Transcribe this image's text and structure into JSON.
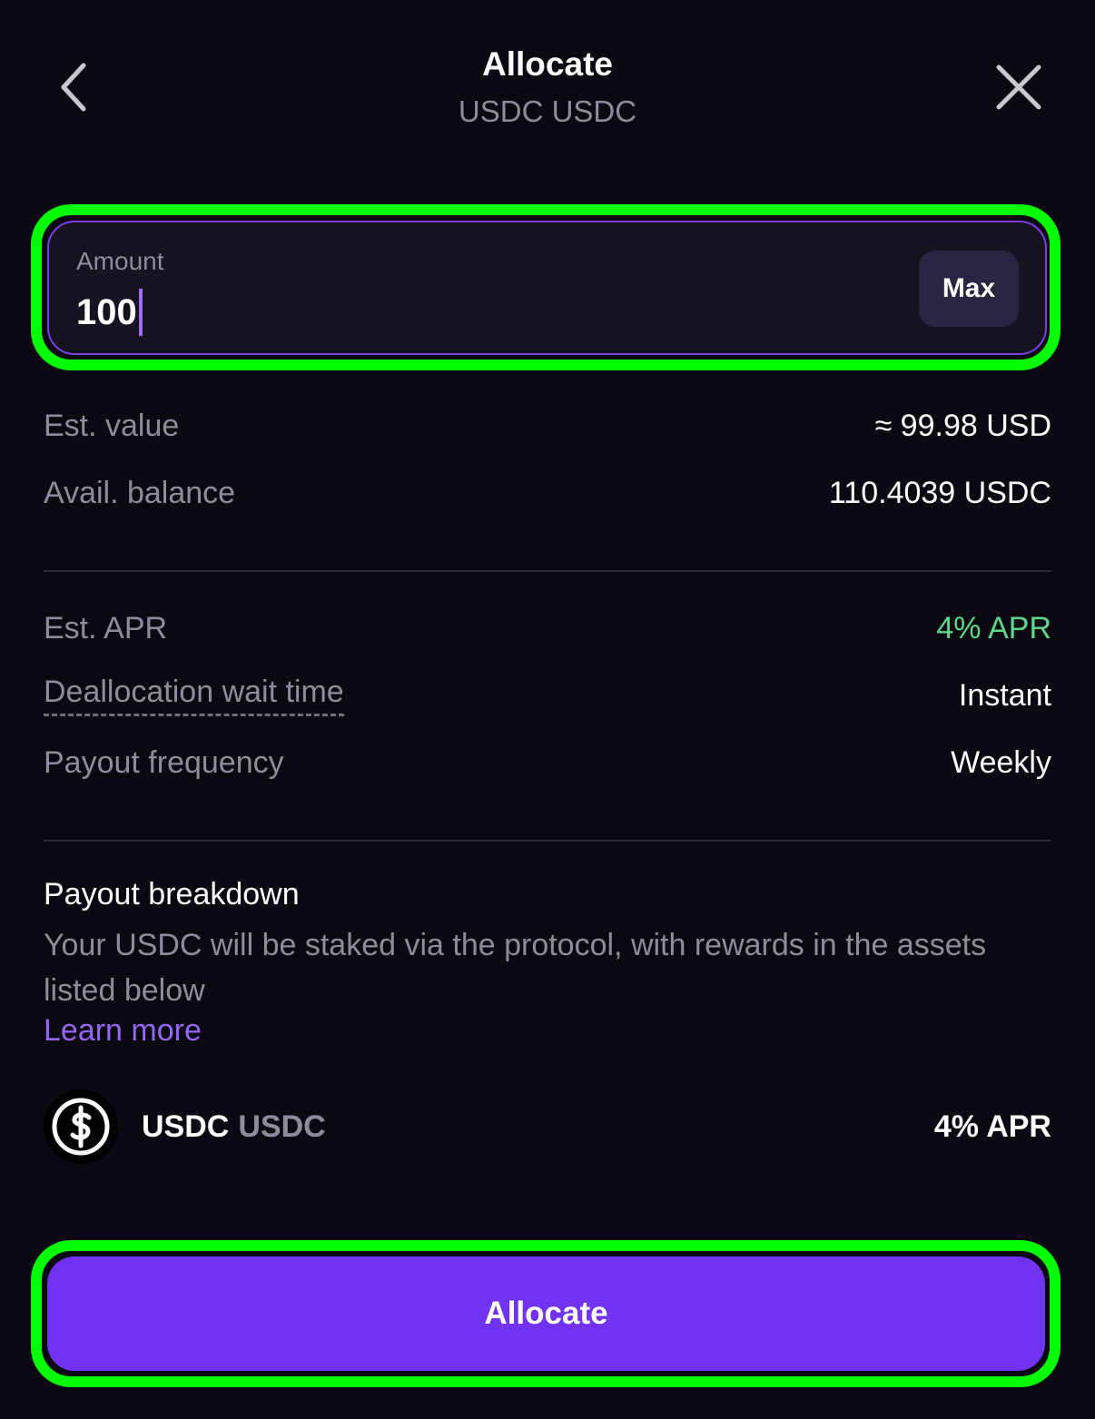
{
  "header": {
    "title": "Allocate",
    "subtitle": "USDC USDC",
    "back_icon": "chevron-left-icon",
    "close_icon": "close-icon"
  },
  "amount": {
    "label": "Amount",
    "value": "100",
    "max_label": "Max"
  },
  "summary": {
    "est_value_label": "Est. value",
    "est_value": "≈ 99.98 USD",
    "balance_label": "Avail. balance",
    "balance": "110.4039 USDC"
  },
  "details": {
    "apr_label": "Est. APR",
    "apr": "4% APR",
    "wait_label": "Deallocation wait time",
    "wait": "Instant",
    "frequency_label": "Payout frequency",
    "frequency": "Weekly"
  },
  "breakdown": {
    "title": "Payout breakdown",
    "description": "Your USDC will be staked via the  protocol, with rewards in the assets listed below",
    "learn_more": "Learn more",
    "asset": {
      "name": "USDC",
      "ticker": "USDC",
      "apr": "4% APR",
      "icon": "usdc-coin-icon"
    }
  },
  "action": {
    "allocate_label": "Allocate"
  },
  "colors": {
    "background": "#0a0911",
    "accent": "#7232f2",
    "highlight": "#00ff00",
    "positive": "#5fd58a",
    "link": "#9566f2",
    "muted_text": "#8d8c9c"
  }
}
